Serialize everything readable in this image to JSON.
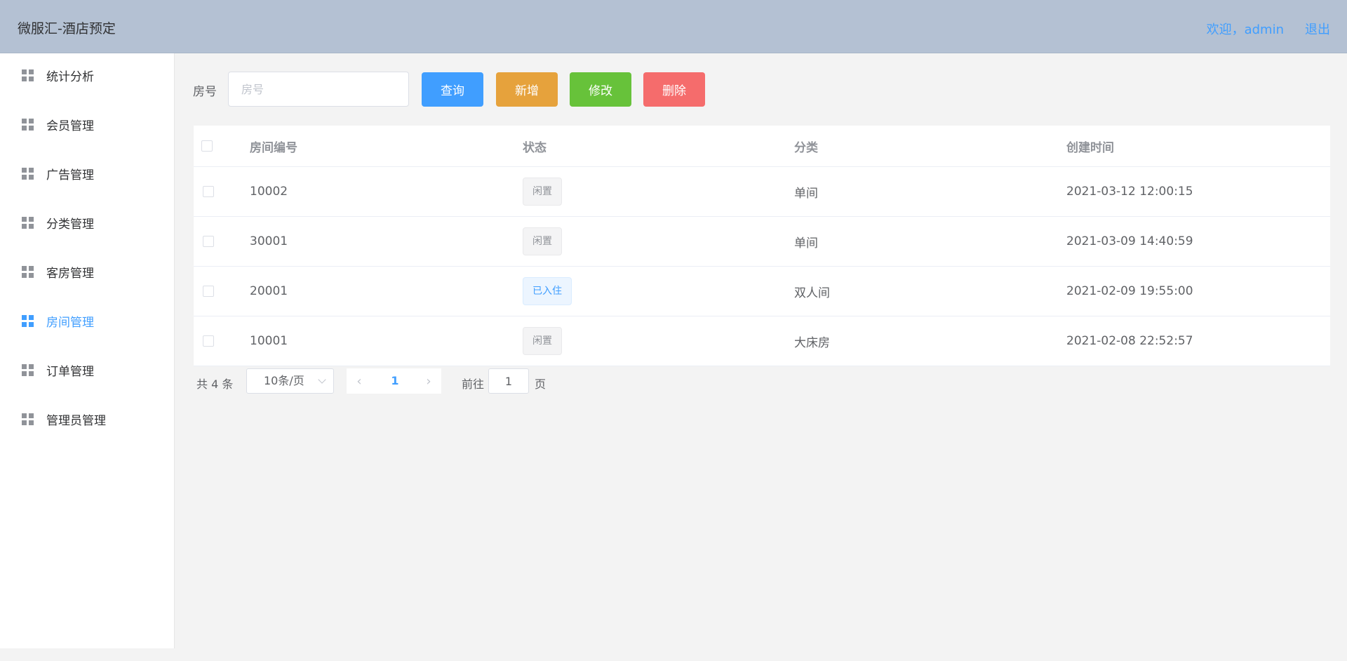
{
  "header": {
    "title": "微服汇-酒店预定",
    "welcome": "欢迎，admin",
    "logout": "退出"
  },
  "sidebar": {
    "items": [
      {
        "label": "统计分析",
        "icon": "grid-icon"
      },
      {
        "label": "会员管理",
        "icon": "grid-icon"
      },
      {
        "label": "广告管理",
        "icon": "grid-icon"
      },
      {
        "label": "分类管理",
        "icon": "grid-icon"
      },
      {
        "label": "客房管理",
        "icon": "grid-icon"
      },
      {
        "label": "房间管理",
        "icon": "grid-icon",
        "active": true
      },
      {
        "label": "订单管理",
        "icon": "grid-icon"
      },
      {
        "label": "管理员管理",
        "icon": "grid-icon"
      }
    ],
    "active_color": "#409eff"
  },
  "search": {
    "label": "房号",
    "placeholder": "房号",
    "value": ""
  },
  "toolbar": {
    "query_label": "查询",
    "add_label": "新增",
    "edit_label": "修改",
    "delete_label": "删除",
    "colors": {
      "query": "#409eff",
      "add": "#e6a23c",
      "edit": "#67c23a",
      "delete": "#f56c6c"
    }
  },
  "table": {
    "columns": [
      "房间编号",
      "状态",
      "分类",
      "创建时间"
    ],
    "rows": [
      {
        "room": "10002",
        "status": "闲置",
        "status_type": "idle",
        "category": "单间",
        "created": "2021-03-12 12:00:15"
      },
      {
        "room": "30001",
        "status": "闲置",
        "status_type": "idle",
        "category": "单间",
        "created": "2021-03-09 14:40:59"
      },
      {
        "room": "20001",
        "status": "已入住",
        "status_type": "occupied",
        "category": "双人间",
        "created": "2021-02-09 19:55:00"
      },
      {
        "room": "10001",
        "status": "闲置",
        "status_type": "idle",
        "category": "大床房",
        "created": "2021-02-08 22:52:57"
      }
    ]
  },
  "pagination": {
    "total_text": "共 4 条",
    "page_size": "10条/页",
    "current_page": "1",
    "goto_label": "前往",
    "goto_value": "1",
    "page_unit": "页"
  }
}
